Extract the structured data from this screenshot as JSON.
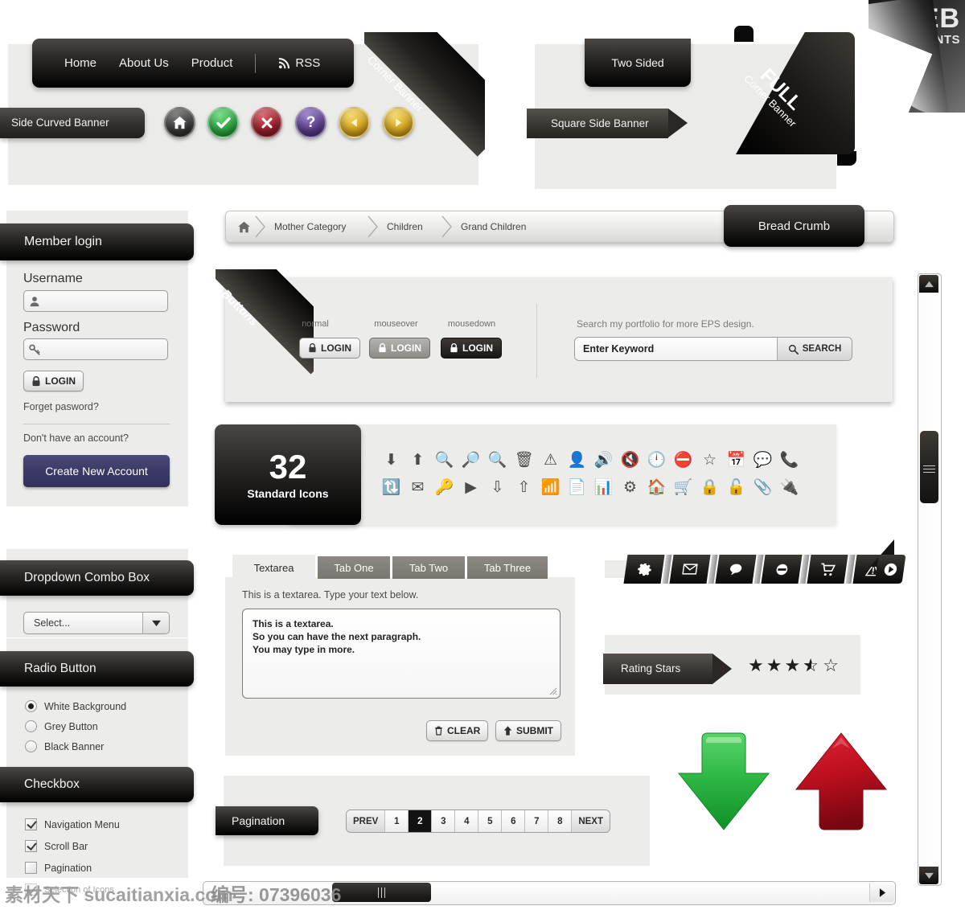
{
  "brand": {
    "line1": "WEB",
    "line2": "ELEMENTS"
  },
  "top_left": {
    "nav": {
      "items": [
        "Home",
        "About Us",
        "Product"
      ],
      "rss_label": "RSS",
      "rss_icon": "rss-icon"
    },
    "side_curved_banner": "Side Curved Banner",
    "corner_banner": "Corner Banner",
    "circle_buttons": [
      {
        "name": "home-icon",
        "color": "#3a3a3a",
        "glyph": "home"
      },
      {
        "name": "check-icon",
        "color": "#2ea843",
        "glyph": "check"
      },
      {
        "name": "close-icon",
        "color": "#9b1f2b",
        "glyph": "cross"
      },
      {
        "name": "help-icon",
        "color": "#5c3f8c",
        "glyph": "question"
      },
      {
        "name": "prev-icon",
        "color": "#d9a920",
        "glyph": "left"
      },
      {
        "name": "next-icon",
        "color": "#d9a920",
        "glyph": "right"
      }
    ]
  },
  "top_right": {
    "two_sided": "Two Sided",
    "square_side_banner": "Square Side Banner",
    "full_corner_small": "Corner Banner",
    "full_corner_big": "FULL"
  },
  "login": {
    "title": "Member login",
    "username_label": "Username",
    "username_value": "",
    "username_icon": "user-icon",
    "password_label": "Password",
    "password_value": "",
    "password_icon": "key-icon",
    "login_button": "LOGIN",
    "login_icon": "lock-icon",
    "forgot": "Forget pasword?",
    "no_account": "Don't have an account?",
    "create_button": "Create New Account",
    "create_color": "#3b3966"
  },
  "dropdown": {
    "title": "Dropdown Combo Box",
    "selected": "Select...",
    "arrow_icon": "chevron-down-icon"
  },
  "radio": {
    "title": "Radio Button",
    "options": [
      {
        "label": "White Background",
        "checked": true
      },
      {
        "label": "Grey Button",
        "checked": false
      },
      {
        "label": "Black Banner",
        "checked": false
      }
    ]
  },
  "checkbox": {
    "title": "Checkbox",
    "options": [
      {
        "label": "Navigation Menu",
        "checked": true
      },
      {
        "label": "Scroll Bar",
        "checked": true
      },
      {
        "label": "Pagination",
        "checked": false
      },
      {
        "label": "Selection of Icons",
        "checked": true
      }
    ]
  },
  "breadcrumb": {
    "home_icon": "home-icon",
    "items": [
      "Mother Category",
      "Children",
      "Grand Children"
    ],
    "tab_label": "Bread Crumb"
  },
  "buttons_panel": {
    "corner_label": "Buttons",
    "states": [
      {
        "state": "normal",
        "label": "LOGIN"
      },
      {
        "state": "mouseover",
        "label": "LOGIN"
      },
      {
        "state": "mousedown",
        "label": "LOGIN"
      }
    ],
    "search_caption": "Search my portfolio for more EPS design.",
    "search_value": "Enter Keyword",
    "search_placeholder": "Enter Keyword",
    "search_button": "SEARCH",
    "search_icon": "search-icon"
  },
  "icons_panel": {
    "count": "32",
    "caption": "Standard Icons",
    "row1": [
      "arrow-down-icon",
      "arrow-up-icon",
      "zoom-in-icon",
      "zoom-out-icon",
      "search-icon",
      "trash-icon",
      "warning-icon",
      "user-icon",
      "volume-on-icon",
      "volume-mute-icon",
      "clock-icon",
      "block-icon",
      "star-icon",
      "calendar-icon",
      "comment-icon",
      "phone-icon"
    ],
    "row2": [
      "refresh-icon",
      "mail-icon",
      "key-icon",
      "play-icon",
      "collapse-down-icon",
      "collapse-up-icon",
      "rss-icon",
      "document-icon",
      "chart-icon",
      "gear-icon",
      "home-icon",
      "cart-icon",
      "lock-closed-icon",
      "lock-open-icon",
      "attachment-icon",
      "plug-icon"
    ]
  },
  "tabs": {
    "items": [
      {
        "label": "Textarea",
        "active": true
      },
      {
        "label": "Tab One",
        "active": false
      },
      {
        "label": "Tab Two",
        "active": false
      },
      {
        "label": "Tab Three",
        "active": false
      }
    ],
    "hint": "This is a textarea. Type your text below.",
    "textarea_value": "This is a textarea.\nSo you can have the next paragraph.\nYou may type in more.",
    "clear_button": "CLEAR",
    "clear_icon": "trash-icon",
    "submit_button": "SUBMIT",
    "submit_icon": "arrow-up-icon"
  },
  "ribbon": {
    "icons": [
      "gear-icon",
      "mail-icon",
      "comment-icon",
      "block-icon",
      "cart-icon",
      "warning-icon",
      "play-icon"
    ]
  },
  "rating": {
    "label": "Rating Stars",
    "value": 3.5,
    "max": 5
  },
  "arrows": {
    "down_color": "#21a83a",
    "up_color": "#b4121f"
  },
  "pagination": {
    "label": "Pagination",
    "prev": "PREV",
    "next": "NEXT",
    "pages": [
      "1",
      "2",
      "3",
      "4",
      "5",
      "6",
      "7",
      "8"
    ],
    "current": "2"
  },
  "scrollbars": {
    "v_up_icon": "triangle-up-icon",
    "v_down_icon": "triangle-down-icon",
    "h_right_icon": "triangle-right-icon"
  },
  "watermark": {
    "left": "素材天下 sucaitianxia.com",
    "right": "编号: 07396036"
  }
}
